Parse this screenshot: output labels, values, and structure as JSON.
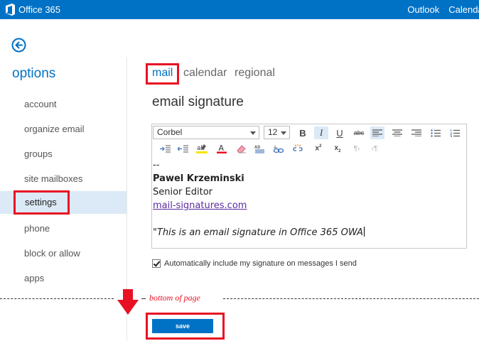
{
  "topbar": {
    "brand": "Office 365",
    "nav": [
      "Outlook",
      "Calendar"
    ]
  },
  "left": {
    "title": "options",
    "items": [
      {
        "label": "account"
      },
      {
        "label": "organize email"
      },
      {
        "label": "groups"
      },
      {
        "label": "site mailboxes"
      },
      {
        "label": "settings",
        "active": true
      },
      {
        "label": "phone"
      },
      {
        "label": "block or allow"
      },
      {
        "label": "apps"
      }
    ]
  },
  "tabs": [
    {
      "label": "mail",
      "active": true
    },
    {
      "label": "calendar"
    },
    {
      "label": "regional"
    }
  ],
  "section_title": "email signature",
  "editor": {
    "font": "Corbel",
    "size": "12",
    "lines": {
      "dash": "--",
      "name": "Pawel Krzeminski",
      "role": "Senior Editor",
      "link": "mail-signatures.com",
      "quote": "\"This is an email signature in Office 365 OWA"
    }
  },
  "auto_include": {
    "checked": true,
    "label": "Automatically include my signature on messages I send"
  },
  "annotation": {
    "bottom_label": "bottom of page"
  },
  "save_label": "save",
  "colors": {
    "brand_blue": "#0072c6",
    "highlight_red": "#e81123",
    "active_nav_bg": "#dce9f6"
  }
}
